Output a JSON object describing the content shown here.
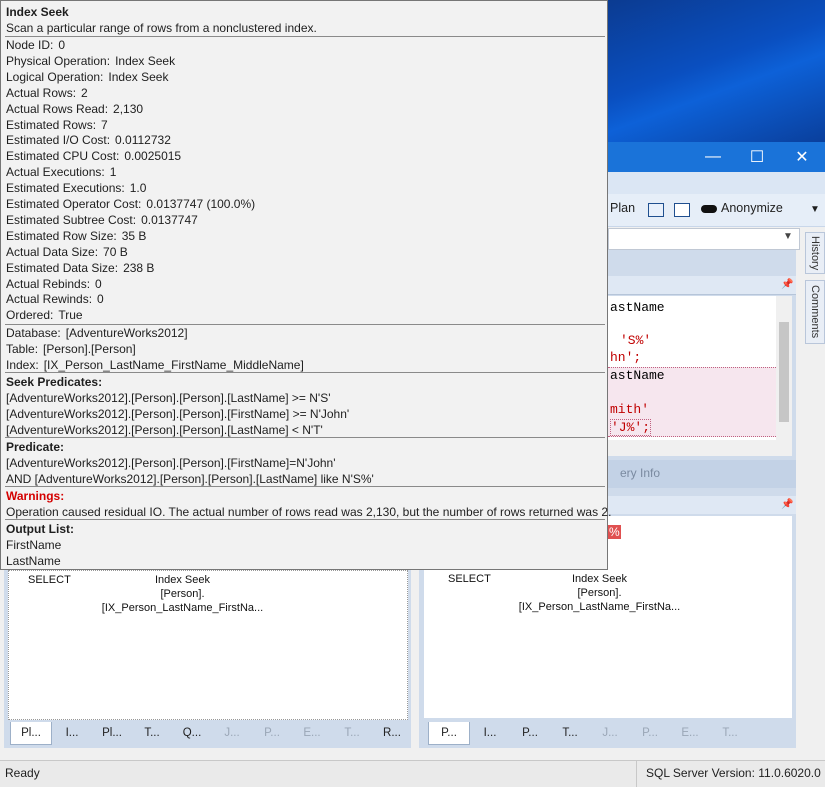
{
  "tooltip": {
    "title": "Index Seek",
    "description": "Scan a particular range of rows from a nonclustered index.",
    "props": [
      {
        "k": "Node ID:",
        "v": "0"
      },
      {
        "k": "Physical Operation:",
        "v": "Index Seek"
      },
      {
        "k": "Logical Operation:",
        "v": "Index Seek"
      },
      {
        "k": "Actual Rows:",
        "v": "2"
      },
      {
        "k": "Actual Rows Read:",
        "v": "2,130"
      },
      {
        "k": "Estimated Rows:",
        "v": "7"
      },
      {
        "k": "Estimated I/O Cost:",
        "v": "0.0112732"
      },
      {
        "k": "Estimated CPU Cost:",
        "v": "0.0025015"
      },
      {
        "k": "Actual Executions:",
        "v": "1"
      },
      {
        "k": "Estimated Executions:",
        "v": "1.0"
      },
      {
        "k": "Estimated Operator Cost:",
        "v": "0.0137747 (100.0%)"
      },
      {
        "k": "Estimated Subtree Cost:",
        "v": "0.0137747"
      },
      {
        "k": "Estimated Row Size:",
        "v": "35 B"
      },
      {
        "k": "Actual Data Size:",
        "v": "70 B"
      },
      {
        "k": "Estimated Data Size:",
        "v": "238 B"
      },
      {
        "k": "Actual Rebinds:",
        "v": "0"
      },
      {
        "k": "Actual Rewinds:",
        "v": "0"
      },
      {
        "k": "Ordered:",
        "v": "True"
      }
    ],
    "objects": [
      {
        "k": "Database:",
        "v": "[AdventureWorks2012]"
      },
      {
        "k": "Table:",
        "v": "[Person].[Person]"
      },
      {
        "k": "Index:",
        "v": "[IX_Person_LastName_FirstName_MiddleName]"
      }
    ],
    "seek_header": "Seek Predicates:",
    "seek_lines": [
      "[AdventureWorks2012].[Person].[Person].[LastName] >= N'S'",
      "[AdventureWorks2012].[Person].[Person].[FirstName] >= N'John'",
      "[AdventureWorks2012].[Person].[Person].[LastName] < N'T'"
    ],
    "pred_header": "Predicate:",
    "pred_lines": [
      "[AdventureWorks2012].[Person].[Person].[FirstName]=N'John'",
      "AND [AdventureWorks2012].[Person].[Person].[LastName] like N'S%'"
    ],
    "warn_header": "Warnings:",
    "warn_text": "Operation caused residual IO. The actual number of rows read was 2,130, but the number of rows returned was 2.",
    "output_header": "Output List:",
    "output_lines": [
      "FirstName",
      "LastName"
    ]
  },
  "window": {
    "minimize": "—",
    "maximize": "☐",
    "close": "✕"
  },
  "toolbar": {
    "plan_label": "Plan",
    "anonymize_label": "Anonymize"
  },
  "side_tabs": [
    "History",
    "Comments"
  ],
  "query_fragments": [
    "astName",
    "'S%'",
    "hn';",
    "astName",
    "mith'",
    "'J%';"
  ],
  "query_info_label": "ery Info",
  "percent_fragment": "%",
  "left_plan": {
    "select": "SELECT",
    "seek": [
      "Index Seek",
      "[Person].",
      "[IX_Person_LastName_FirstNa..."
    ]
  },
  "right_plan": {
    "select": "SELECT",
    "seek": [
      "Index Seek",
      "[Person].",
      "[IX_Person_LastName_FirstNa..."
    ]
  },
  "left_tabs": [
    "Pl...",
    "I...",
    "Pl...",
    "T...",
    "Q...",
    "J...",
    "P...",
    "E...",
    "T...",
    "R..."
  ],
  "left_tabs_dim": [
    false,
    false,
    false,
    false,
    false,
    true,
    true,
    true,
    true,
    false
  ],
  "right_tabs": [
    "P...",
    "I...",
    "P...",
    "T...",
    "J...",
    "P...",
    "E...",
    "T..."
  ],
  "right_tabs_dim": [
    false,
    false,
    false,
    false,
    true,
    true,
    true,
    true
  ],
  "status": {
    "left": "Ready",
    "right": "SQL Server Version: 11.0.6020.0"
  }
}
